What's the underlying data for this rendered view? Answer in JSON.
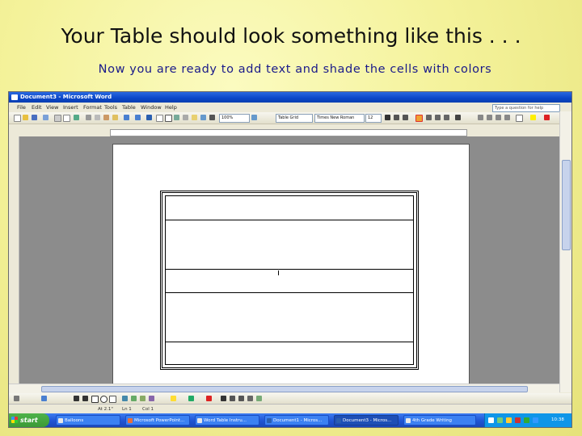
{
  "slide": {
    "title": "Your Table should look something like this . . .",
    "subtitle": "Now you are ready to add text and shade the cells with colors"
  },
  "window": {
    "title": "Document3 - Microsoft Word",
    "help_placeholder": "Type a question for help"
  },
  "menu": {
    "items": [
      "File",
      "Edit",
      "View",
      "Insert",
      "Format",
      "Tools",
      "Table",
      "Window",
      "Help"
    ]
  },
  "formatting": {
    "zoom": "100%",
    "style": "Table Grid",
    "font": "Times New Roman",
    "size": "12"
  },
  "document": {
    "table": {
      "rows": 5,
      "border_style": "double"
    }
  },
  "status": {
    "at": "At 2.1\"",
    "ln": "Ln 1",
    "col": "Col 1"
  },
  "taskbar": {
    "start_label": "start",
    "tasks": [
      "Balloons",
      "Microsoft PowerPoint...",
      "Word Table Instru...",
      "Document1 - Micros...",
      "Document3 - Micros...",
      "4th Grade Writing"
    ],
    "clock": "10:38 AM"
  },
  "colors": {
    "slide_background": "#f4f29a",
    "subtitle": "#1a1a8a",
    "titlebar": "#0a46c8",
    "taskbar": "#2157d6",
    "start_button": "#3a9a36"
  }
}
